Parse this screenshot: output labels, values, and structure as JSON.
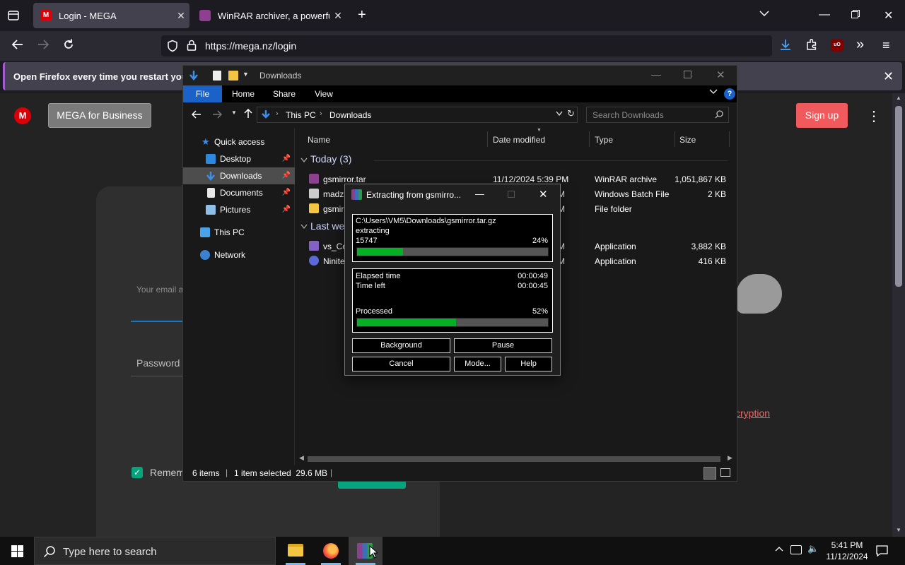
{
  "browser": {
    "tabs": [
      {
        "title": "Login - MEGA",
        "favicon_color": "#d90007"
      },
      {
        "title": "WinRAR archiver, a powerful to",
        "favicon_color": "#8e3f8f"
      }
    ],
    "url": "https://mega.nz/login",
    "notification": "Open Firefox every time you restart your co"
  },
  "mega": {
    "business_button": "MEGA for Business",
    "signup_button": "Sign up",
    "email_label": "Your email a",
    "password_label": "Password",
    "remember_label": "Remem",
    "encryption_link": "cryption",
    "accent": "#f0373a"
  },
  "explorer": {
    "title": "Downloads",
    "ribbon_tabs": [
      "File",
      "Home",
      "Share",
      "View"
    ],
    "breadcrumb": [
      "This PC",
      "Downloads"
    ],
    "search_placeholder": "Search Downloads",
    "nav": {
      "quick_access": "Quick access",
      "items": [
        "Desktop",
        "Downloads",
        "Documents",
        "Pictures"
      ],
      "this_pc": "This PC",
      "network": "Network"
    },
    "columns": [
      "Name",
      "Date modified",
      "Type",
      "Size"
    ],
    "group_today": "Today (3)",
    "group_last": "Last we",
    "rows_today": [
      {
        "name": "gsmirror.tar",
        "date": "11/12/2024 5:39 PM",
        "type": "WinRAR archive",
        "size": "1,051,867 KB"
      },
      {
        "name": "madz",
        "date": "M",
        "type": "Windows Batch File",
        "size": "2 KB"
      },
      {
        "name": "gsmir",
        "date": "M",
        "type": "File folder",
        "size": ""
      }
    ],
    "rows_last": [
      {
        "name": "vs_Co",
        "date": "M",
        "type": "Application",
        "size": "3,882 KB"
      },
      {
        "name": "Ninite",
        "date": "M",
        "type": "Application",
        "size": "416 KB"
      }
    ],
    "status": {
      "items": "6 items",
      "selected": "1 item selected  29.6 MB"
    }
  },
  "winrar": {
    "title": "Extracting from gsmirro...",
    "path": "C:\\Users\\VM5\\Downloads\\gsmirror.tar.gz",
    "action": "extracting",
    "file_count": "15747",
    "file_percent": "24%",
    "file_progress": 0.24,
    "elapsed_label": "Elapsed time",
    "elapsed_value": "00:00:49",
    "left_label": "Time left",
    "left_value": "00:00:45",
    "processed_label": "Processed",
    "processed_percent": "52%",
    "processed_progress": 0.52,
    "buttons": [
      "Background",
      "Pause",
      "Cancel",
      "Mode...",
      "Help"
    ]
  },
  "taskbar": {
    "search_placeholder": "Type here to search",
    "time": "5:41 PM",
    "date": "11/12/2024"
  }
}
